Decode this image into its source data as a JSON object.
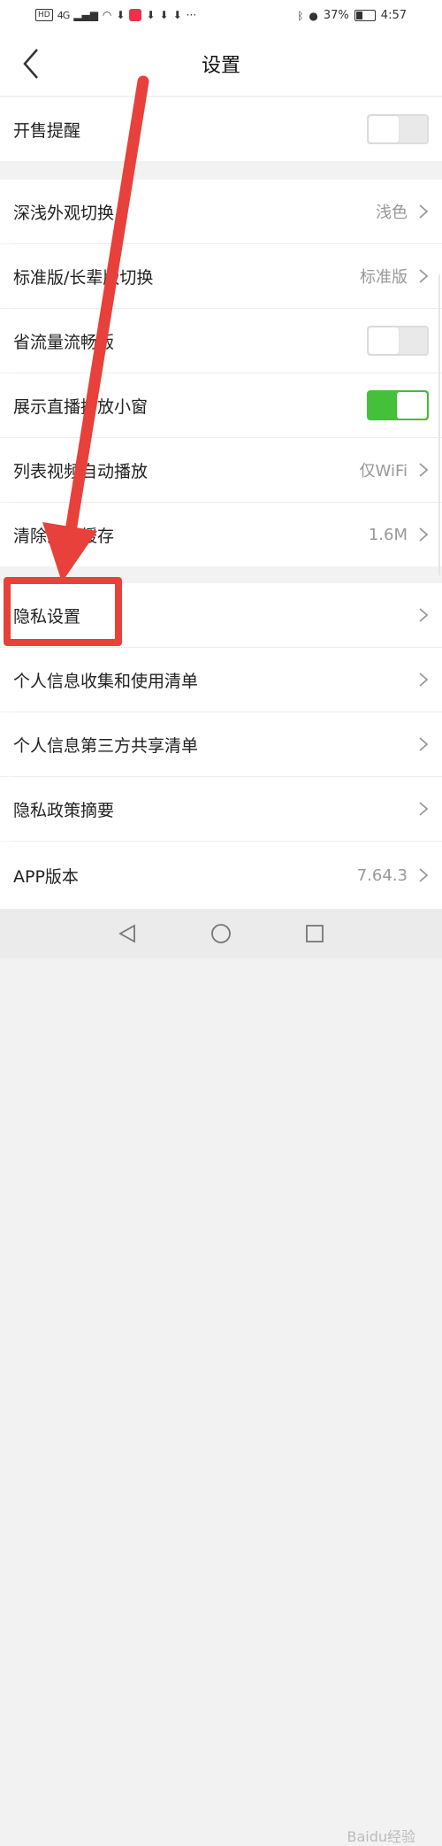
{
  "status_bar": {
    "left_badge": "HD",
    "network": "4G",
    "battery": "37%",
    "battery_level": 0.37,
    "time": "4:57"
  },
  "nav": {
    "back_icon": "chevron-left-icon",
    "title": "设置"
  },
  "settings": {
    "sale_reminder": {
      "label": "开售提醒",
      "toggle_on": false
    },
    "appearance": {
      "label": "深浅外观切换",
      "value": "浅色"
    },
    "edition": {
      "label": "标准版/长辈版切换",
      "value": "标准版"
    },
    "data_saver": {
      "label": "省流量流畅版",
      "toggle_on": false
    },
    "live_window": {
      "label": "展示直播播放小窗",
      "toggle_on": true
    },
    "autoplay": {
      "label": "列表视频自动播放",
      "value": "仅WiFi"
    },
    "clear_cache": {
      "label": "清除图片缓存",
      "value": "1.6M"
    },
    "privacy_settings": {
      "label": "隐私设置"
    },
    "personal_info_list": {
      "label": "个人信息收集和使用清单"
    },
    "third_party_list": {
      "label": "个人信息第三方共享清单"
    },
    "privacy_summary": {
      "label": "隐私政策摘要"
    },
    "app_version": {
      "label": "APP版本",
      "value": "7.64.3"
    }
  },
  "colors": {
    "accent_green": "#44c03b",
    "annotation_red": "#e8403a"
  },
  "watermark": "Baidu经验"
}
